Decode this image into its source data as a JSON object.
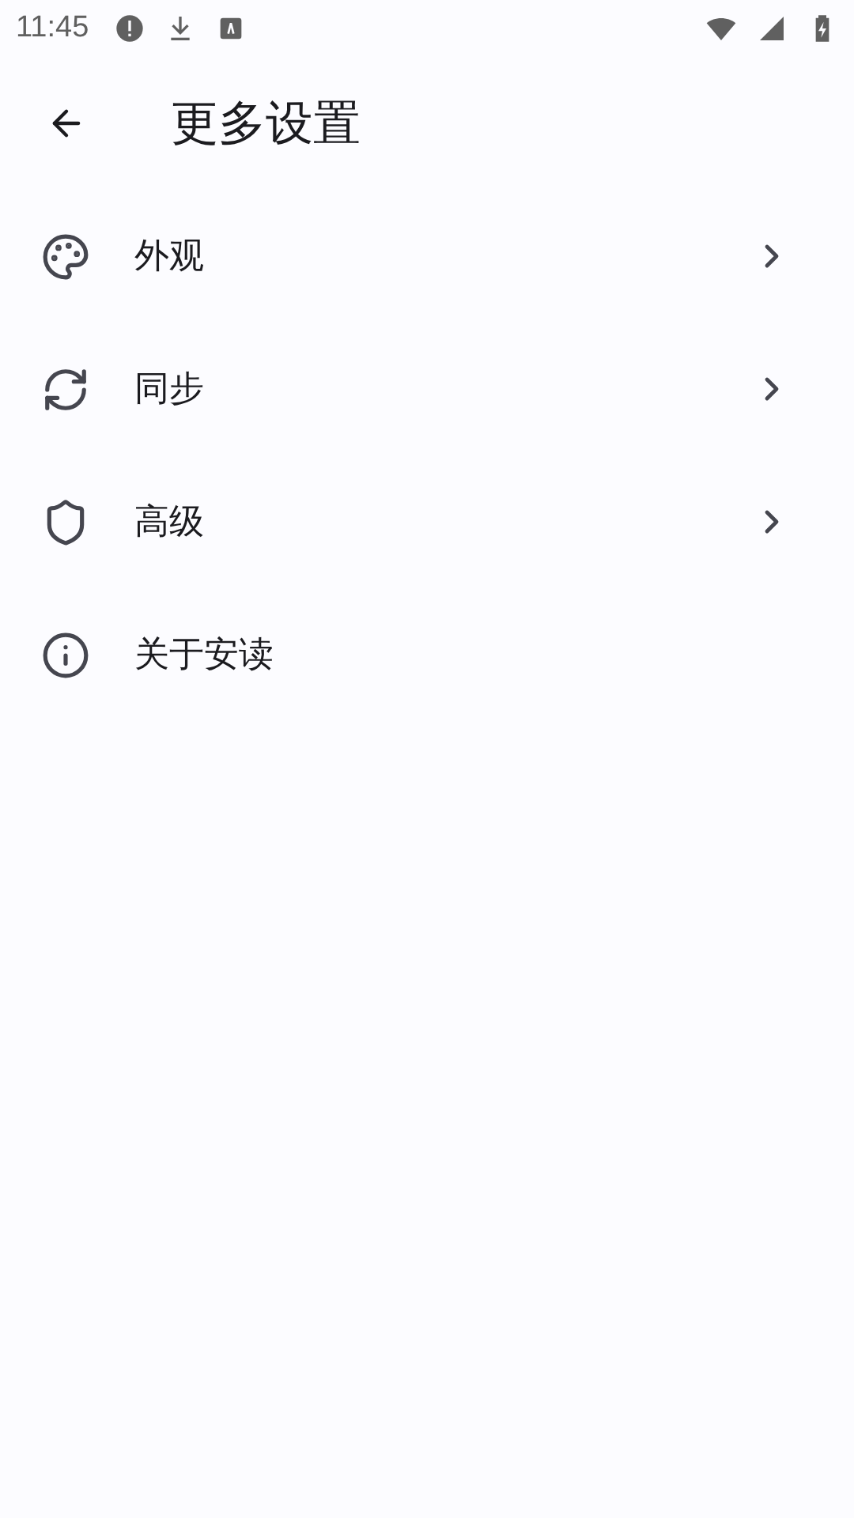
{
  "status_bar": {
    "time": "11:45"
  },
  "app_bar": {
    "title": "更多设置"
  },
  "items": [
    {
      "label": "外观",
      "kind": "submenu"
    },
    {
      "label": "同步",
      "kind": "submenu"
    },
    {
      "label": "高级",
      "kind": "submenu"
    },
    {
      "label": "关于安读",
      "kind": "link"
    }
  ]
}
